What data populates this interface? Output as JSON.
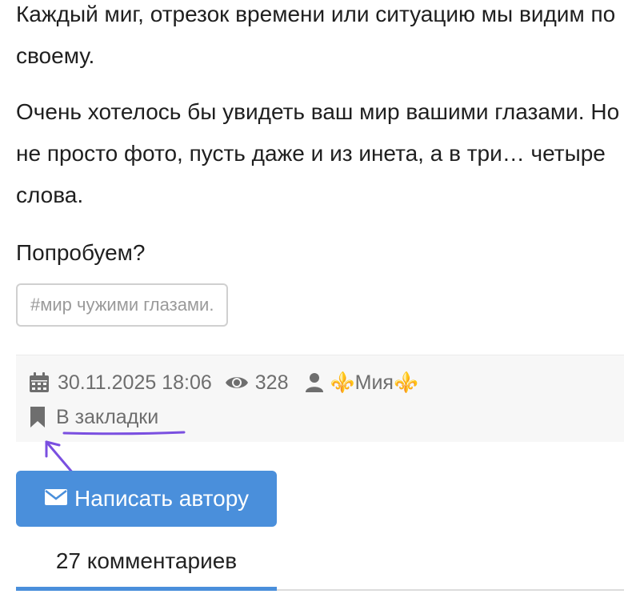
{
  "post": {
    "paragraphs": [
      "Каждый миг, отрезок времени или ситуацию мы видим по своему.",
      "Очень хотелось бы увидеть ваш мир вашими глазами. Но не просто фото, пусть даже и из инета, а в три… четыре слова.",
      "Попробуем?"
    ],
    "tag": "#мир чужими глазами."
  },
  "meta": {
    "datetime": "30.11.2025 18:06",
    "views": "328",
    "author": "⚜️Мия⚜️",
    "bookmark_label": "В закладки"
  },
  "actions": {
    "write_author_label": "Написать автору"
  },
  "comments_tab": {
    "label": "27 комментариев"
  },
  "colors": {
    "accent": "#4a8fdb",
    "annotation": "#7a4fe0",
    "meta_text": "#6e6e6e"
  }
}
